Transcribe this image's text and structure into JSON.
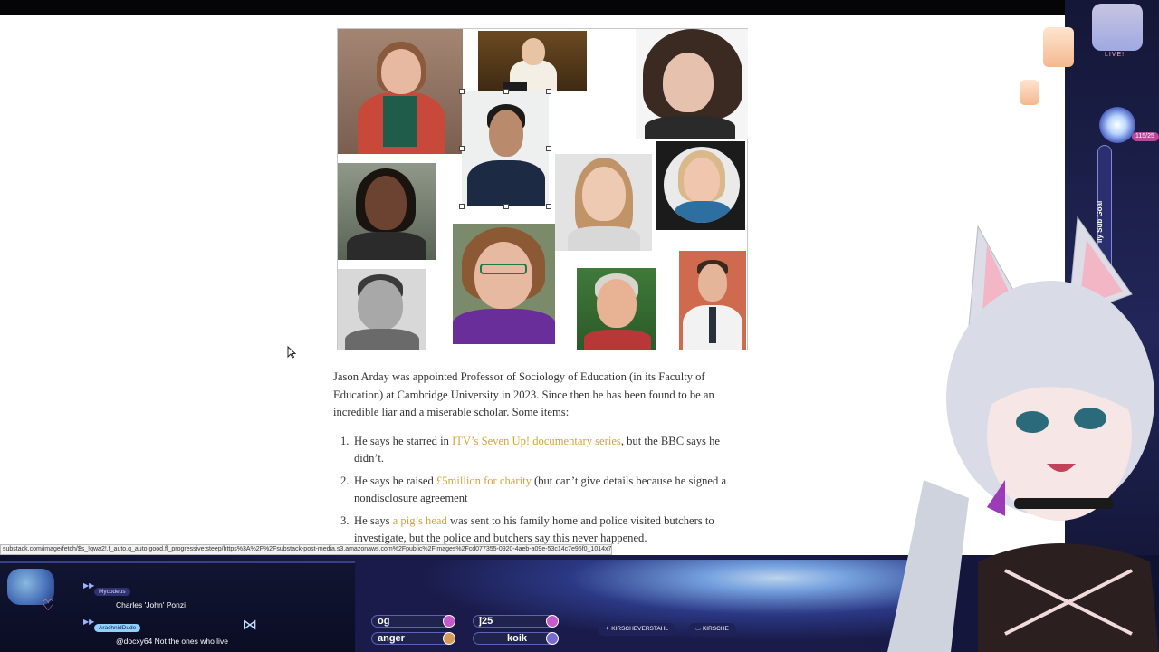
{
  "article": {
    "paragraph": "Jason Arday was appointed Professor of Sociology of Education (in its Faculty of Education) at Cambridge University in 2023. Since then he has been found to be an incredible liar and a miserable scholar. Some items:",
    "items": [
      {
        "num": "1.",
        "before": "He says he starred in ",
        "link": "ITV’s Seven Up! documentary series",
        "after": ", but the BBC says he didn’t."
      },
      {
        "num": "2.",
        "before": "He says he raised ",
        "link": "£5million for charity",
        "after": " (but can’t give details because he signed a nondisclosure agreement"
      },
      {
        "num": "3.",
        "before": "He says ",
        "link": "a pig’s head",
        "after": " was sent to his family home and police visited butchers to investigate, but the police and butchers say this never happened."
      }
    ]
  },
  "status_url": "substack.com/image/fetch/$s_!qwa2!,f_auto,q_auto:good,fl_progressive:steep/https%3A%2F%2Fsubstack-post-media.s3.amazonaws.com%2Fpublic%2Fimages%2Fcd077355-0920-4aeb-a09e-53c14c7e95f0_1014x792.png",
  "chat": [
    {
      "user": "Mycodeus",
      "text": "Charles 'John' Ponzi",
      "user_color": "#dcd2ff",
      "user_bg": "#2e3270"
    },
    {
      "user": "ArachnidDude",
      "text": "@docxy64 Not the ones who live",
      "user_color": "#1a1b4a",
      "user_bg": "#8fd0ff"
    }
  ],
  "overlay": {
    "pills": [
      "og",
      "anger",
      "ĵ25",
      "koik"
    ],
    "twitter_tag": "KIRSCHEVERSTAHL",
    "chat_tag": "KIRSCHE",
    "live": "LIVE!",
    "sub_goal": "ily Sub Goal",
    "sub_count": "115/25"
  },
  "icons": {
    "twitter": "twitter-icon",
    "chat": "chat-bubble-icon",
    "heart": "heart-icon",
    "cursor": "mouse-cursor-icon"
  },
  "colors": {
    "link": "#d4a43a",
    "overlay_dark": "#1a1b4a",
    "accent_pink": "#c45acb"
  }
}
